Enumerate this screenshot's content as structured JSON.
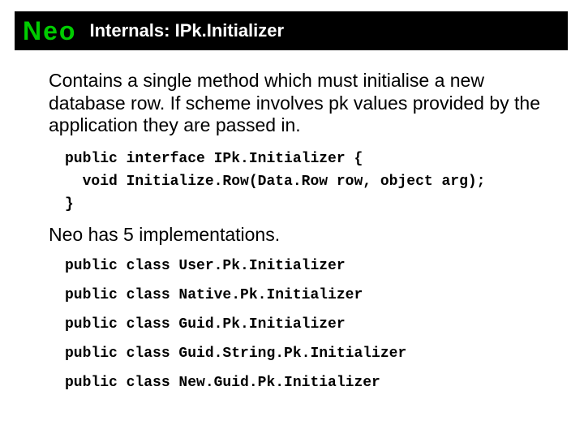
{
  "header": {
    "logo": "Neo",
    "title": "Internals: IPk.Initializer"
  },
  "intro": "Contains a single method which must initialise a new database row. If scheme involves pk values provided by the application they are passed in.",
  "code": {
    "line1": "public interface IPk.Initializer {",
    "line2": "  void Initialize.Row(Data.Row row, object arg);",
    "line3": "}"
  },
  "mid": "Neo has 5 implementations.",
  "impls": [
    "public class User.Pk.Initializer",
    "public class Native.Pk.Initializer",
    "public class Guid.Pk.Initializer",
    "public class Guid.String.Pk.Initializer",
    "public class New.Guid.Pk.Initializer"
  ]
}
